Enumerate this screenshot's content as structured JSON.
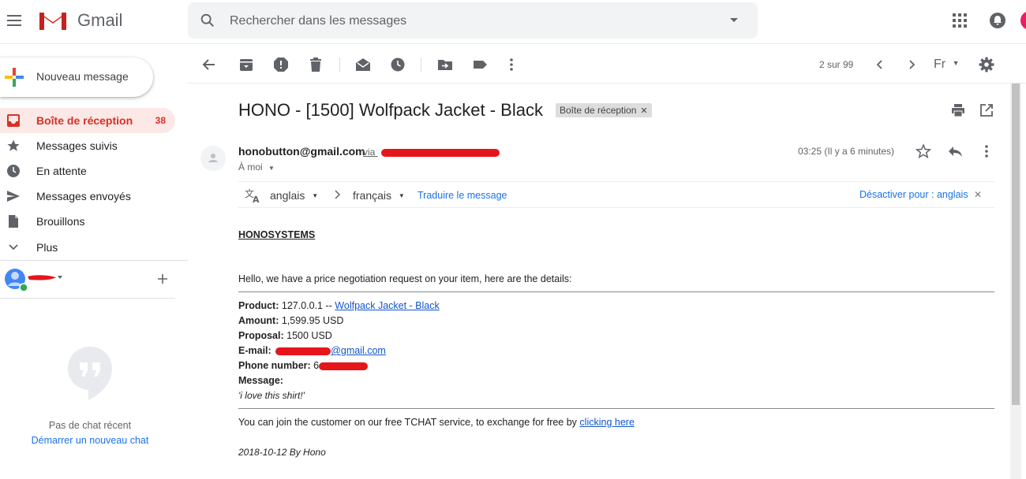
{
  "header": {
    "brand": "Gmail",
    "search_placeholder": "Rechercher dans les messages"
  },
  "sidebar": {
    "compose_label": "Nouveau message",
    "items": [
      {
        "label": "Boîte de réception",
        "count": "38",
        "icon": "inbox-icon"
      },
      {
        "label": "Messages suivis",
        "icon": "star-icon"
      },
      {
        "label": "En attente",
        "icon": "clock-icon"
      },
      {
        "label": "Messages envoyés",
        "icon": "send-icon"
      },
      {
        "label": "Brouillons",
        "icon": "draft-icon"
      },
      {
        "label": "Plus",
        "icon": "chevron-down-icon"
      }
    ],
    "no_recent_chat": "Pas de chat récent",
    "start_chat": "Démarrer un nouveau chat"
  },
  "toolbar": {
    "pager": "2 sur 99",
    "lang": "Fr"
  },
  "message": {
    "subject": "HONO - [1500] Wolfpack Jacket - Black",
    "label_chip": "Boîte de réception",
    "sender_email": "honobutton@gmail.com",
    "via": "via",
    "to": "À moi",
    "time": "03:25 (Il y a 6 minutes)"
  },
  "translate": {
    "source": "anglais",
    "target": "français",
    "translate_link": "Traduire le message",
    "disable_link": "Désactiver pour : anglais"
  },
  "body": {
    "company": "HONOSYSTEMS",
    "intro": "Hello, we have a price negotiation request on your item, here are the details:",
    "product_label": "Product:",
    "product_prefix": "127.0.0.1 --",
    "product_link": "Wolfpack Jacket - Black",
    "amount_label": "Amount:",
    "amount_value": "1,599.95 USD",
    "proposal_label": "Proposal:",
    "proposal_value": "1500 USD",
    "email_label": "E-mail:",
    "email_suffix": "@gmail.com",
    "phone_label": "Phone number:",
    "phone_prefix": "6",
    "message_label": "Message:",
    "message_value": "'i love this shirt!'",
    "join_text": "You can join the customer on our free TCHAT service, to exchange for free by",
    "join_link": "clicking here",
    "signature": "2018-10-12 By Hono"
  },
  "colors": {
    "accent_red": "#d93025",
    "inbox_bg": "#fce8e6",
    "link_blue": "#1a73e8",
    "redaction": "#e5161b"
  }
}
